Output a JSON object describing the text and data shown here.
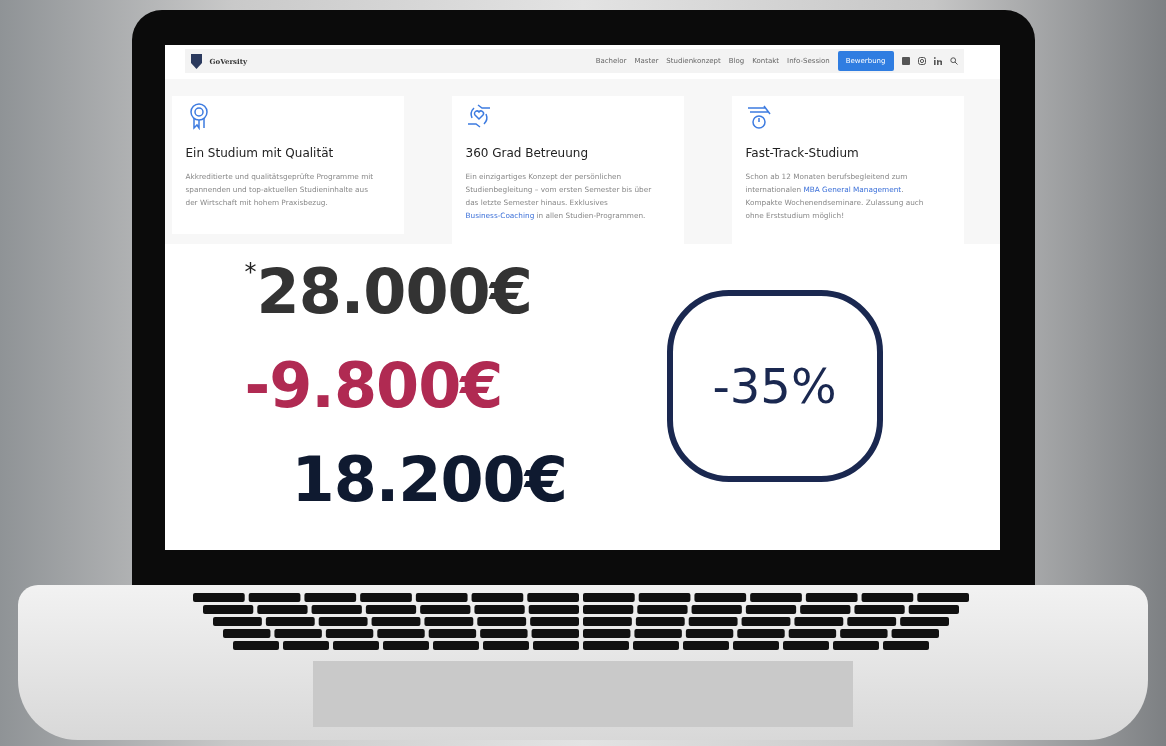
{
  "site": {
    "logo": "GoVersity",
    "nav": [
      {
        "label": "Bachelor",
        "kind": "link"
      },
      {
        "label": "Master",
        "kind": "link"
      },
      {
        "label": "Studienkonzept",
        "kind": "link"
      },
      {
        "label": "Blog",
        "kind": "link"
      },
      {
        "label": "Kontakt",
        "kind": "link"
      },
      {
        "label": "Info-Session",
        "kind": "link"
      },
      {
        "label": "Bewerbung",
        "kind": "button"
      }
    ],
    "social": [
      {
        "kind": "facebook"
      },
      {
        "kind": "instagram"
      },
      {
        "kind": "linkedin"
      },
      {
        "kind": "search"
      }
    ]
  },
  "cards": [
    {
      "title": "Ein Studium mit Qualität",
      "body": [
        {
          "text": "Akkreditierte und qualitätsgeprüfte Programme mit spannenden und top-aktuellen Studieninhalte aus der Wirtschaft mit hohem Praxisbezug.",
          "link": false
        }
      ]
    },
    {
      "title": "360 Grad Betreuung",
      "body": [
        {
          "text": "Ein einzigartiges Konzept der persönlichen Studienbegleitung – vom ersten Semester bis über das letzte Semester hinaus. Exklusives ",
          "link": false
        },
        {
          "text": "Business-Coaching",
          "link": true
        },
        {
          "text": " in allen Studien-Programmen.",
          "link": false
        }
      ]
    },
    {
      "title": "Fast-Track-Studium",
      "body": [
        {
          "text": "Schon ab 12 Monaten berufsbegleitend zum internationalen ",
          "link": false
        },
        {
          "text": "MBA General Management",
          "link": true
        },
        {
          "text": ". Kompakte Wochenendseminare. Zulassung auch ohne Erststudium möglich!",
          "link": false
        }
      ]
    }
  ],
  "prices": [
    {
      "kind": "original",
      "note": "*",
      "amount": "28.000€"
    },
    {
      "kind": "discount",
      "amount": "-9.800€"
    },
    {
      "kind": "final",
      "amount": "18.200€"
    }
  ],
  "badge": "-35%"
}
